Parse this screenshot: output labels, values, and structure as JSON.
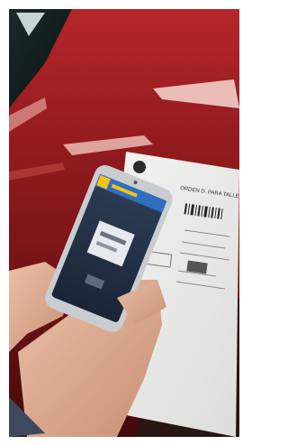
{
  "photo": {
    "description_alt": "",
    "document": {
      "title": "ORDEN D. PARA TALLER"
    }
  }
}
